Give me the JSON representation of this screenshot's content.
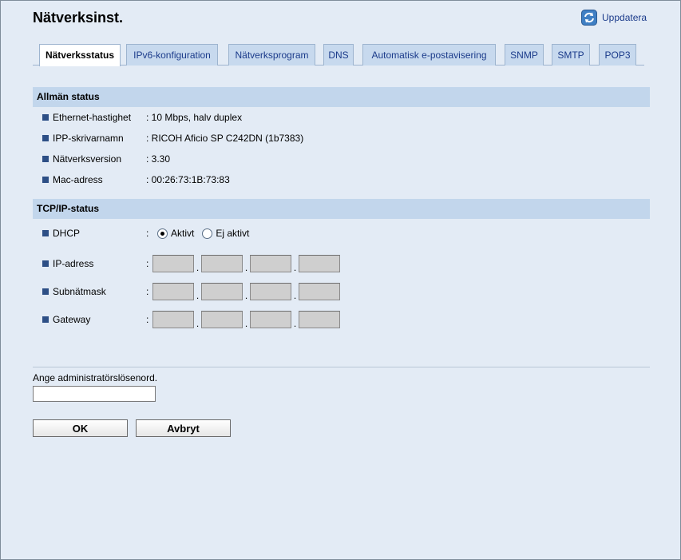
{
  "header": {
    "title": "Nätverksinst.",
    "refresh_label": "Uppdatera"
  },
  "tabs": [
    {
      "label": "Nätverksstatus",
      "active": true
    },
    {
      "label": "IPv6-konfiguration",
      "active": false
    },
    {
      "label": "Nätverksprogram",
      "active": false
    },
    {
      "label": "DNS",
      "active": false
    },
    {
      "label": "Automatisk e-postavisering",
      "active": false
    },
    {
      "label": "SNMP",
      "active": false
    },
    {
      "label": "SMTP",
      "active": false
    },
    {
      "label": "POP3",
      "active": false
    }
  ],
  "general_status": {
    "heading": "Allmän status",
    "rows": [
      {
        "label": "Ethernet-hastighet",
        "value": ": 10 Mbps, halv duplex"
      },
      {
        "label": "IPP-skrivarnamn",
        "value": ": RICOH Aficio SP C242DN (1b7383)"
      },
      {
        "label": "Nätverksversion",
        "value": ": 3.30"
      },
      {
        "label": "Mac-adress",
        "value": ": 00:26:73:1B:73:83"
      }
    ]
  },
  "tcpip_status": {
    "heading": "TCP/IP-status",
    "dhcp": {
      "label": "DHCP",
      "options": [
        "Aktivt",
        "Ej aktivt"
      ],
      "selected": "Aktivt"
    },
    "address_fields": [
      {
        "label": "IP-adress",
        "octets": [
          "",
          "",
          "",
          ""
        ]
      },
      {
        "label": "Subnätmask",
        "octets": [
          "",
          "",
          "",
          ""
        ]
      },
      {
        "label": "Gateway",
        "octets": [
          "",
          "",
          "",
          ""
        ]
      }
    ]
  },
  "admin": {
    "password_label": "Ange administratörslösenord.",
    "password_value": ""
  },
  "buttons": {
    "ok": "OK",
    "cancel": "Avbryt"
  },
  "colors": {
    "background": "#e3ebf5",
    "section_header": "#c2d6ec",
    "tab_inactive": "#c7d9ee",
    "bullet": "#2d4f86",
    "link": "#1a3a8a"
  }
}
